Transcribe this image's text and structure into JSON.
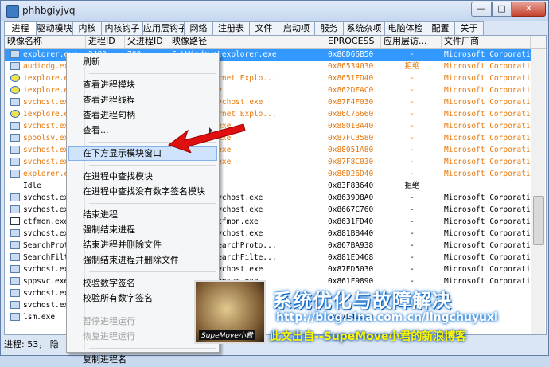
{
  "window": {
    "title": "phhbgiyjvq",
    "min_label": "—",
    "max_label": "□",
    "close_label": "✕"
  },
  "tabs": [
    "进程",
    "驱动模块",
    "内核",
    "内核钩子",
    "应用层钩子",
    "网络",
    "注册表",
    "文件",
    "启动项",
    "服务",
    "系统杂项",
    "电脑体检",
    "配置",
    "关于"
  ],
  "columns": [
    "映像名称",
    "进程ID",
    "父进程ID",
    "映像路径",
    "EPROCESS",
    "应用层访...",
    "文件厂商"
  ],
  "rows": [
    {
      "name": "explorer.exe",
      "pid": "2480",
      "ppid": "700",
      "path": "C:\\Windows\\explorer.exe",
      "eproc": "0x86D66B50",
      "access": "-",
      "vendor": "Microsoft Corporation",
      "style": "sel",
      "icon": "app"
    },
    {
      "name": "audiodg.exe",
      "pid": "",
      "ppid": "",
      "path": "",
      "eproc": "0x86534030",
      "access": "拒绝",
      "vendor": "Microsoft Corporation",
      "style": "orange",
      "icon": "app"
    },
    {
      "name": "iexplore.exe",
      "pid": "",
      "ppid": "",
      "path": "Files\\Internet Explo...",
      "eproc": "0x8651FD40",
      "access": "-",
      "vendor": "Microsoft Corporation",
      "style": "orange",
      "icon": "ie"
    },
    {
      "name": "iexplore.exe",
      "pid": "",
      "ppid": "",
      "path": "xplorer.exe",
      "eproc": "0x862DFAC0",
      "access": "-",
      "vendor": "Microsoft Corporation",
      "style": "orange",
      "icon": "ie"
    },
    {
      "name": "svchost.exe",
      "pid": "",
      "ppid": "",
      "path": "System32\\svchost.exe",
      "eproc": "0x87F4F030",
      "access": "-",
      "vendor": "Microsoft Corporation",
      "style": "orange",
      "icon": "app"
    },
    {
      "name": "iexplore.exe",
      "pid": "",
      "ppid": "",
      "path": "Files\\Internet Explo...",
      "eproc": "0x86C76660",
      "access": "-",
      "vendor": "Microsoft Corporation",
      "style": "orange",
      "icon": "ie"
    },
    {
      "name": "svchost.exe",
      "pid": "",
      "ppid": "",
      "path": "2\\svchost.exe",
      "eproc": "0x8801BA40",
      "access": "-",
      "vendor": "Microsoft Corporation",
      "style": "orange",
      "icon": "app"
    },
    {
      "name": "spoolsv.exe",
      "pid": "",
      "ppid": "",
      "path": "2\\spoolsv.exe",
      "eproc": "0x87FC3580",
      "access": "-",
      "vendor": "Microsoft Corporation",
      "style": "orange",
      "icon": "app"
    },
    {
      "name": "svchost.exe",
      "pid": "",
      "ppid": "",
      "path": "2\\svchost.exe",
      "eproc": "0x88051A80",
      "access": "-",
      "vendor": "Microsoft Corporation",
      "style": "orange",
      "icon": "app"
    },
    {
      "name": "svchost.exe",
      "pid": "",
      "ppid": "",
      "path": "2\\svchost.exe",
      "eproc": "0x87F8C030",
      "access": "-",
      "vendor": "Microsoft Corporation",
      "style": "orange",
      "icon": "app"
    },
    {
      "name": "explorer.exe",
      "pid": "",
      "ppid": "",
      "path": "orer.exe",
      "eproc": "0x86D26D40",
      "access": "-",
      "vendor": "Microsoft Corporation",
      "style": "orange",
      "icon": "folder"
    },
    {
      "name": "Idle",
      "pid": "",
      "ppid": "",
      "path": "",
      "eproc": "0x83F83640",
      "access": "拒绝",
      "vendor": "",
      "style": "black",
      "icon": "none"
    },
    {
      "name": "svchost.exe",
      "pid": "",
      "ppid": "",
      "path": "System32\\svchost.exe",
      "eproc": "0x8639D8A0",
      "access": "-",
      "vendor": "Microsoft Corporation",
      "style": "black",
      "icon": "app"
    },
    {
      "name": "svchost.exe",
      "pid": "",
      "ppid": "",
      "path": "System32\\svchost.exe",
      "eproc": "0x8667C760",
      "access": "-",
      "vendor": "Microsoft Corporation",
      "style": "black",
      "icon": "app"
    },
    {
      "name": "ctfmon.exe",
      "pid": "",
      "ppid": "",
      "path": "System32\\ctfmon.exe",
      "eproc": "0x8631FD40",
      "access": "-",
      "vendor": "Microsoft Corporation",
      "style": "black",
      "icon": "pen"
    },
    {
      "name": "svchost.exe",
      "pid": "",
      "ppid": "",
      "path": "System32\\svchost.exe",
      "eproc": "0x881BB440",
      "access": "-",
      "vendor": "Microsoft Corporation",
      "style": "black",
      "icon": "app"
    },
    {
      "name": "SearchProto...",
      "pid": "",
      "ppid": "",
      "path": "System32\\SearchProto...",
      "eproc": "0x867BA938",
      "access": "-",
      "vendor": "Microsoft Corporation",
      "style": "black",
      "icon": "app"
    },
    {
      "name": "SearchFilte...",
      "pid": "",
      "ppid": "",
      "path": "System32\\SearchFilte...",
      "eproc": "0x881ED468",
      "access": "-",
      "vendor": "Microsoft Corporation",
      "style": "black",
      "icon": "app"
    },
    {
      "name": "svchost.exe",
      "pid": "",
      "ppid": "",
      "path": "System32\\svchost.exe",
      "eproc": "0x87ED5030",
      "access": "-",
      "vendor": "Microsoft Corporation",
      "style": "black",
      "icon": "app"
    },
    {
      "name": "sppsvc.exe",
      "pid": "",
      "ppid": "",
      "path": "System32\\sppsvc.exe",
      "eproc": "0x861F9890",
      "access": "-",
      "vendor": "Microsoft Corporation",
      "style": "black",
      "icon": "app"
    },
    {
      "name": "svchost.exe",
      "pid": "",
      "ppid": "",
      "path": "",
      "eproc": "",
      "access": "",
      "vendor": "",
      "style": "black",
      "icon": "app"
    },
    {
      "name": "svchost.exe",
      "pid": "",
      "ppid": "",
      "path": "",
      "eproc": "",
      "access": "",
      "vendor": "",
      "style": "black",
      "icon": "app"
    },
    {
      "name": "lsm.exe",
      "pid": "",
      "ppid": "",
      "path": "",
      "eproc": "0x87E49030",
      "access": "",
      "vendor": "",
      "style": "black",
      "icon": "app"
    }
  ],
  "menu": [
    {
      "label": "刷新",
      "type": "item"
    },
    {
      "type": "sep"
    },
    {
      "label": "查看进程模块",
      "type": "item"
    },
    {
      "label": "查看进程线程",
      "type": "item"
    },
    {
      "label": "查看进程句柄",
      "type": "item"
    },
    {
      "label": "查看...",
      "type": "item",
      "submenu": true
    },
    {
      "type": "sep"
    },
    {
      "label": "在下方显示模块窗口",
      "type": "item",
      "highlight": true
    },
    {
      "type": "sep"
    },
    {
      "label": "在进程中查找模块",
      "type": "item"
    },
    {
      "label": "在进程中查找没有数字签名模块",
      "type": "item"
    },
    {
      "type": "sep"
    },
    {
      "label": "结束进程",
      "type": "item"
    },
    {
      "label": "强制结束进程",
      "type": "item"
    },
    {
      "label": "结束进程并删除文件",
      "type": "item"
    },
    {
      "label": "强制结束进程并删除文件",
      "type": "item"
    },
    {
      "type": "sep"
    },
    {
      "label": "校验数字签名",
      "type": "item"
    },
    {
      "label": "校验所有数字签名",
      "type": "item"
    },
    {
      "type": "sep"
    },
    {
      "label": "暂停进程运行",
      "type": "item",
      "disabled": true
    },
    {
      "label": "恢复进程运行",
      "type": "item",
      "disabled": true
    },
    {
      "type": "sep"
    },
    {
      "label": "复制进程名",
      "type": "item"
    }
  ],
  "status": {
    "text": "进程: 53， 隐"
  },
  "watermark": {
    "title": "系统优化与故障解决",
    "url": "http://blog.sina.com.cn/lingchuyuxi",
    "by": "此文出自--SupeMove小君的新浪博客",
    "sign": "SupeMove小君"
  },
  "colors": {
    "orange": "#e8780a",
    "selected": "#3399ff",
    "arrow": "#e01010"
  }
}
